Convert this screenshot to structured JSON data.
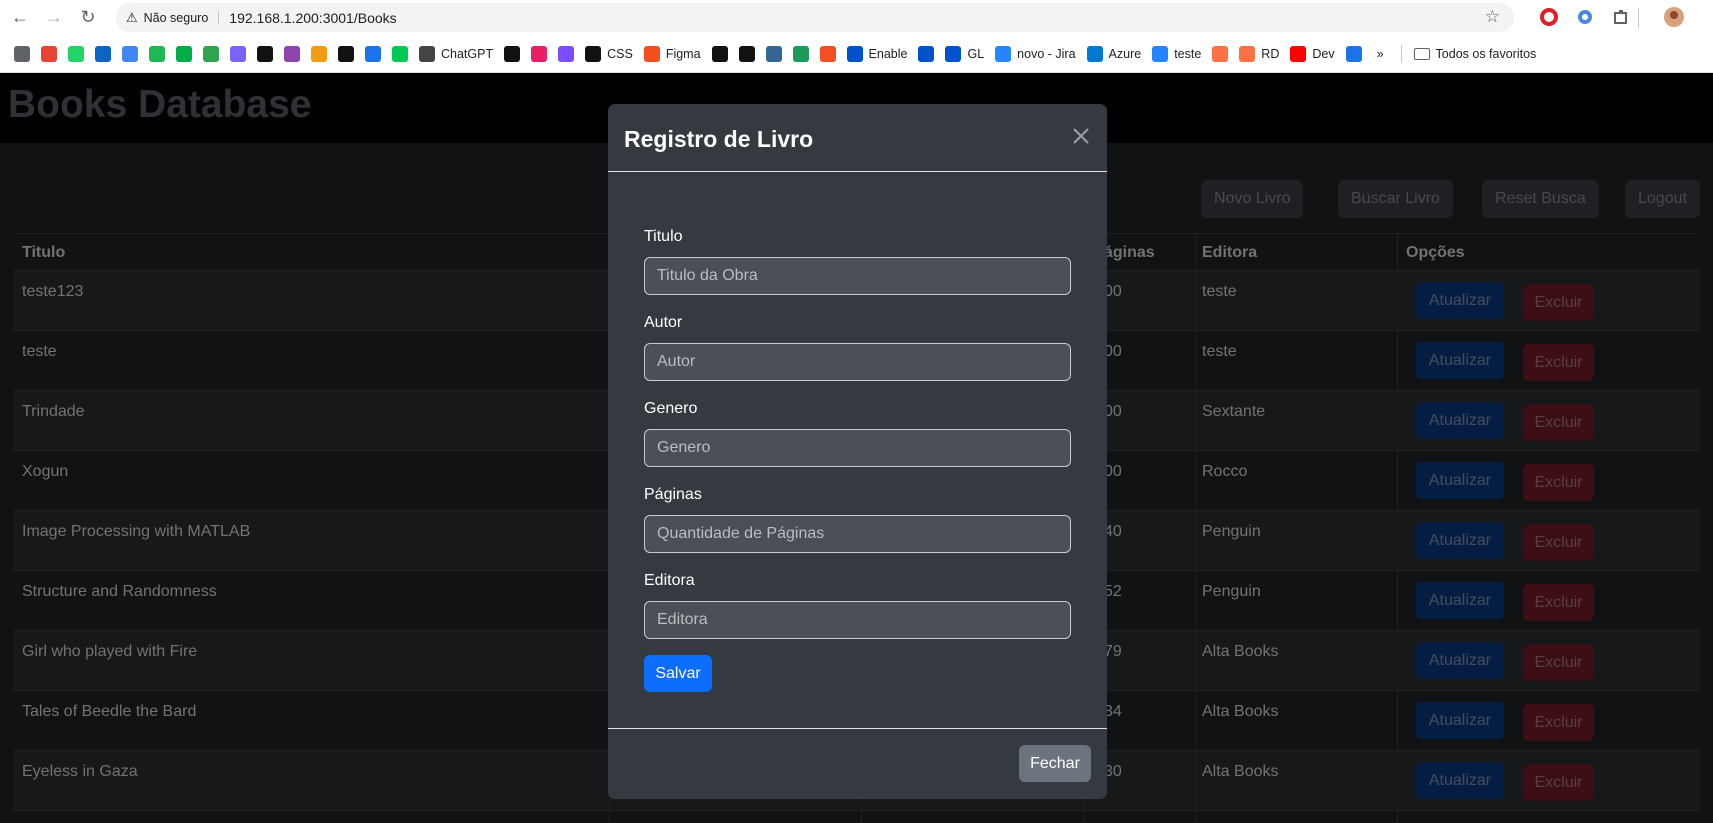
{
  "browser": {
    "security_label": "Não seguro",
    "url": "192.168.1.200:3001/Books",
    "bookmarks": [
      {
        "label": "",
        "icon": "apps-grid-icon",
        "color": "#5f6368"
      },
      {
        "label": "",
        "icon": "gmail-icon",
        "color": "#ea4335"
      },
      {
        "label": "",
        "icon": "whatsapp-icon",
        "color": "#25d366"
      },
      {
        "label": "",
        "icon": "linkedin-icon",
        "color": "#0a66c2"
      },
      {
        "label": "",
        "icon": "translate-icon",
        "color": "#4285f4"
      },
      {
        "label": "",
        "icon": "spotify-icon",
        "color": "#1db954"
      },
      {
        "label": "",
        "icon": "meet-icon",
        "color": "#00ac47"
      },
      {
        "label": "",
        "icon": "clover-icon",
        "color": "#2da44e"
      },
      {
        "label": "",
        "icon": "ef-icon",
        "color": "#7b61ff"
      },
      {
        "label": "",
        "icon": "ampersand-icon",
        "color": "#111111"
      },
      {
        "label": "",
        "icon": "circle-i-icon",
        "color": "#8e44ad"
      },
      {
        "label": "",
        "icon": "rtve-icon",
        "color": "#f39c12"
      },
      {
        "label": "",
        "icon": "x-icon",
        "color": "#111111"
      },
      {
        "label": "",
        "icon": "c-icon",
        "color": "#1a73e8"
      },
      {
        "label": "",
        "icon": "rk-icon",
        "color": "#00c853"
      },
      {
        "label": "ChatGPT",
        "icon": "chatgpt-icon",
        "color": "#444444"
      },
      {
        "label": "",
        "icon": "a-icon",
        "color": "#111111"
      },
      {
        "label": "",
        "icon": "f-icon",
        "color": "#e91e63"
      },
      {
        "label": "",
        "icon": "b-icon",
        "color": "#7c4dff"
      },
      {
        "label": "CSS",
        "icon": "m-icon",
        "color": "#111111"
      },
      {
        "label": "Figma",
        "icon": "figma-icon",
        "color": "#f24e1e"
      },
      {
        "label": "",
        "icon": "github-icon",
        "color": "#111111"
      },
      {
        "label": "",
        "icon": "mongo-icon",
        "color": "#111111"
      },
      {
        "label": "",
        "icon": "elephant-icon",
        "color": "#336791"
      },
      {
        "label": "",
        "icon": "w-icon",
        "color": "#1b9a59"
      },
      {
        "label": "",
        "icon": "microsoft-icon",
        "color": "#f25022"
      },
      {
        "label": "Enable",
        "icon": "enable-icon",
        "color": "#0052cc"
      },
      {
        "label": "",
        "icon": "atlassian-icon",
        "color": "#0052cc"
      },
      {
        "label": "GL",
        "icon": "gl-icon",
        "color": "#0052cc"
      },
      {
        "label": "novo - Jira",
        "icon": "jira-icon",
        "color": "#2684ff"
      },
      {
        "label": "Azure",
        "icon": "azure-icon",
        "color": "#0078d4"
      },
      {
        "label": "teste",
        "icon": "jira2-icon",
        "color": "#2684ff"
      },
      {
        "label": "",
        "icon": "stripe-icon",
        "color": "#ff7043"
      },
      {
        "label": "RD",
        "icon": "rd-icon",
        "color": "#ff7043"
      },
      {
        "label": "Dev",
        "icon": "youtube-icon",
        "color": "#ff0000"
      },
      {
        "label": "",
        "icon": "check-icon",
        "color": "#1a73e8"
      }
    ],
    "more_label": "»",
    "favorites_label": "Todos os favoritos"
  },
  "navbar": {
    "brand": "Books Database"
  },
  "toolbar": {
    "new_label": "Novo Livro",
    "search_label": "Buscar Livro",
    "reset_label": "Reset Busca",
    "logout_label": "Logout"
  },
  "table": {
    "headers": [
      "Titulo",
      "",
      "",
      "Páginas",
      "Editora",
      "Opções"
    ],
    "visible_headers": {
      "titulo": "Titulo",
      "paginas": "áginas",
      "editora": "Editora",
      "opcoes": "Opções"
    },
    "rows": [
      {
        "titulo": "teste123",
        "paginas": "00",
        "editora": "teste"
      },
      {
        "titulo": "teste",
        "paginas": "00",
        "editora": "teste"
      },
      {
        "titulo": "Trindade",
        "paginas": "00",
        "editora": "Sextante"
      },
      {
        "titulo": "Xogun",
        "paginas": "00",
        "editora": "Rocco"
      },
      {
        "titulo": "Image Processing with MATLAB",
        "paginas": "40",
        "editora": "Penguin"
      },
      {
        "titulo": "Structure and Randomness",
        "paginas": "52",
        "editora": "Penguin"
      },
      {
        "titulo": "Girl who played with Fire",
        "paginas": "79",
        "editora": "Alta Books"
      },
      {
        "titulo": "Tales of Beedle the Bard",
        "paginas": "34",
        "editora": "Alta Books"
      },
      {
        "titulo": "Eyeless in Gaza",
        "paginas": "30",
        "editora": "Alta Books"
      }
    ],
    "update_label": "Atualizar",
    "delete_label": "Excluir"
  },
  "modal": {
    "title": "Registro de Livro",
    "fields": [
      {
        "label": "Titulo",
        "placeholder": "Titulo da Obra",
        "value": ""
      },
      {
        "label": "Autor",
        "placeholder": "Autor",
        "value": ""
      },
      {
        "label": "Genero",
        "placeholder": "Genero",
        "value": ""
      },
      {
        "label": "Páginas",
        "placeholder": "Quantidade de Páginas",
        "value": ""
      },
      {
        "label": "Editora",
        "placeholder": "Editora",
        "value": ""
      }
    ],
    "save_label": "Salvar",
    "close_label": "Fechar"
  }
}
